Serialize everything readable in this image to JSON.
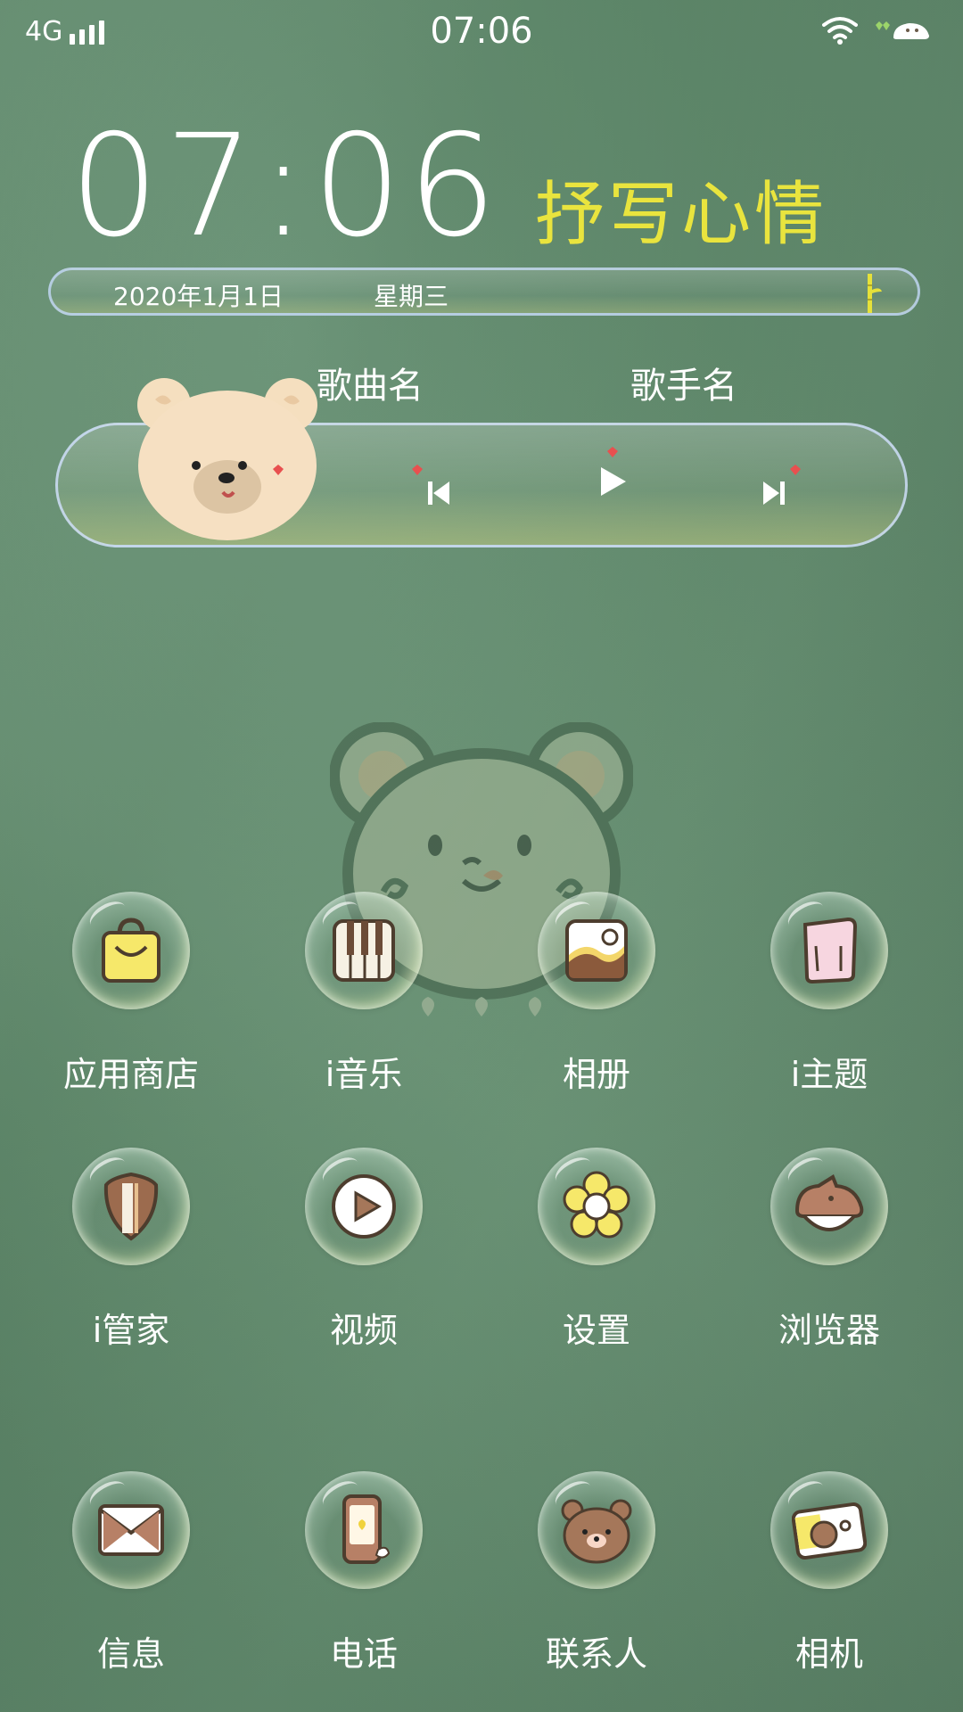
{
  "status_bar": {
    "network": "4G",
    "time": "07:06"
  },
  "widget": {
    "clock": "07:06",
    "mood": "抒写心情",
    "date": "2020年1月1日",
    "weekday": "星期三"
  },
  "music": {
    "song": "歌曲名",
    "singer": "歌手名"
  },
  "apps": [
    {
      "label": "应用商店",
      "icon": "shopping-bag-icon"
    },
    {
      "label": "i音乐",
      "icon": "piano-icon"
    },
    {
      "label": "相册",
      "icon": "gallery-icon"
    },
    {
      "label": "i主题",
      "icon": "theme-icon"
    },
    {
      "label": "i管家",
      "icon": "shield-icon"
    },
    {
      "label": "视频",
      "icon": "play-video-icon"
    },
    {
      "label": "设置",
      "icon": "flower-settings-icon"
    },
    {
      "label": "浏览器",
      "icon": "browser-icon"
    },
    {
      "label": "信息",
      "icon": "envelope-icon"
    },
    {
      "label": "电话",
      "icon": "phone-icon"
    },
    {
      "label": "联系人",
      "icon": "bear-contact-icon"
    },
    {
      "label": "相机",
      "icon": "camera-icon"
    }
  ],
  "colors": {
    "background": "#5f8a6b",
    "mood_text": "#e9e43e",
    "heart": "#e8504f"
  }
}
